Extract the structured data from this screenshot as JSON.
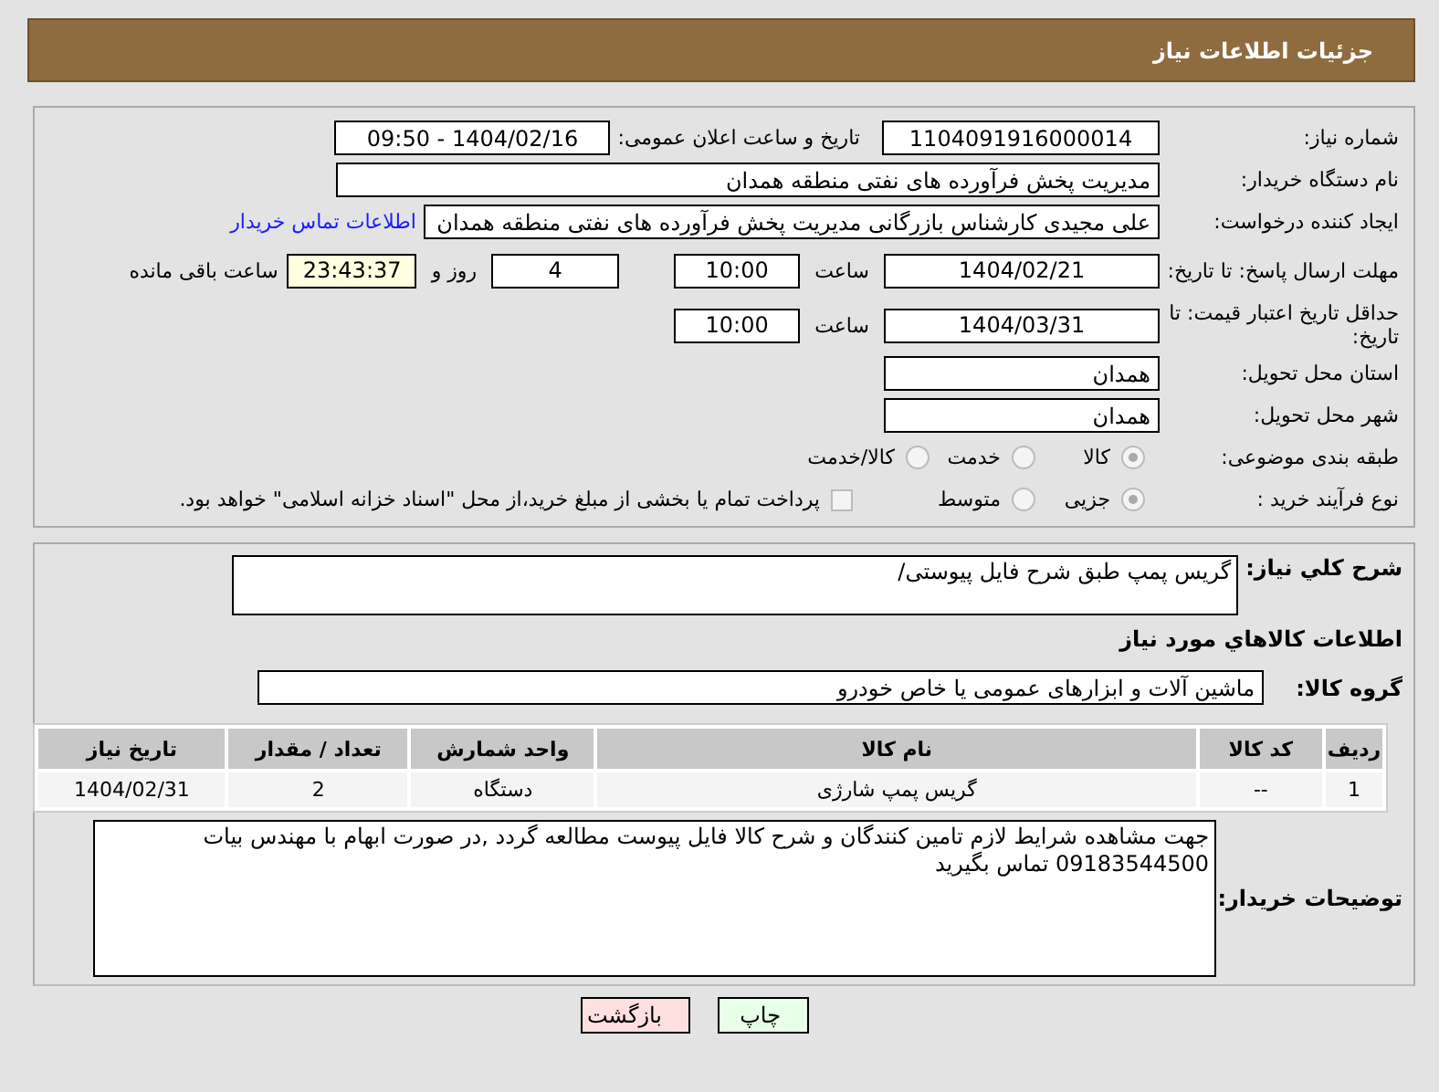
{
  "header": {
    "title": "جزئیات اطلاعات نیاز"
  },
  "need_number": {
    "label": "شماره نیاز:",
    "value": "1104091916000014"
  },
  "announce_datetime": {
    "label": "تاریخ و ساعت اعلان عمومی:",
    "value": "1404/02/16 - 09:50"
  },
  "buyer_org": {
    "label": "نام دستگاه خریدار:",
    "value": "مدیریت پخش فرآورده های نفتی منطقه همدان"
  },
  "requester": {
    "label": "ایجاد کننده درخواست:",
    "value": "علی مجیدی کارشناس بازرگانی مدیریت پخش فرآورده های نفتی منطقه همدان",
    "link": "اطلاعات تماس خریدار"
  },
  "reply_deadline": {
    "label": "مهلت ارسال پاسخ: تا تاریخ:",
    "date": "1404/02/21",
    "time_label": "ساعت",
    "time": "10:00",
    "days": "4",
    "days_label": "روز و",
    "remaining": "23:43:37",
    "remaining_label": "ساعت باقی مانده"
  },
  "price_validity": {
    "label": "حداقل تاریخ اعتبار قیمت: تا تاریخ:",
    "date": "1404/03/31",
    "time_label": "ساعت",
    "time": "10:00"
  },
  "province": {
    "label": "استان محل تحویل:",
    "value": "همدان"
  },
  "city": {
    "label": "شهر محل تحویل:",
    "value": "همدان"
  },
  "category": {
    "label": "طبقه بندی موضوعی:",
    "options": [
      {
        "label": "کالا",
        "selected": true
      },
      {
        "label": "خدمت",
        "selected": false
      },
      {
        "label": "کالا/خدمت",
        "selected": false
      }
    ]
  },
  "process": {
    "label": "نوع فرآیند خرید :",
    "options": [
      {
        "label": "جزیی",
        "selected": true
      },
      {
        "label": "متوسط",
        "selected": false
      }
    ],
    "payment_note": {
      "checked": false,
      "text": "پرداخت تمام یا بخشی از مبلغ خرید،از محل \"اسناد خزانه اسلامی\" خواهد بود."
    }
  },
  "description": {
    "label": "شرح کلي نیاز:",
    "value": "گریس پمپ طبق شرح فایل پیوستی/"
  },
  "goods_heading": "اطلاعات کالاهاي مورد نیاز",
  "goods_group": {
    "label": "گروه کالا:",
    "value": "ماشین آلات و ابزارهای عمومی یا خاص خودرو"
  },
  "table": {
    "columns": [
      "ردیف",
      "کد کالا",
      "نام کالا",
      "واحد شمارش",
      "تعداد / مقدار",
      "تاریخ نیاز"
    ],
    "rows": [
      [
        "1",
        "--",
        "گریس پمپ شارژی",
        "دستگاه",
        "2",
        "1404/02/31"
      ]
    ]
  },
  "buyer_notes": {
    "label": "توضیحات خریدار:",
    "value": "جهت مشاهده شرایط لازم تامین کنندگان و شرح کالا فایل پیوست مطالعه گردد ,در صورت ابهام با مهندس بیات 09183544500 تماس بگیرید"
  },
  "buttons": [
    {
      "label": "چاپ",
      "kind": "print"
    },
    {
      "label": "بازگشت",
      "kind": "back"
    }
  ]
}
